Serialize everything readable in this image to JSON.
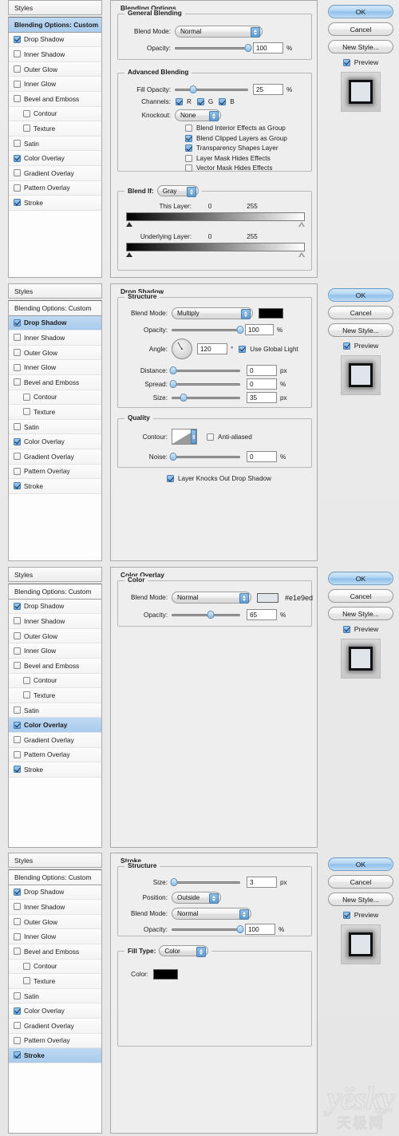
{
  "styles_panel": {
    "header_label": "Styles",
    "blending_options_label": "Blending Options: Custom",
    "items": [
      {
        "label": "Drop Shadow",
        "checked": true,
        "indent": false
      },
      {
        "label": "Inner Shadow",
        "checked": false,
        "indent": false
      },
      {
        "label": "Outer Glow",
        "checked": false,
        "indent": false
      },
      {
        "label": "Inner Glow",
        "checked": false,
        "indent": false
      },
      {
        "label": "Bevel and Emboss",
        "checked": false,
        "indent": false
      },
      {
        "label": "Contour",
        "checked": false,
        "indent": true
      },
      {
        "label": "Texture",
        "checked": false,
        "indent": true
      },
      {
        "label": "Satin",
        "checked": false,
        "indent": false
      },
      {
        "label": "Color Overlay",
        "checked": true,
        "indent": false
      },
      {
        "label": "Gradient Overlay",
        "checked": false,
        "indent": false
      },
      {
        "label": "Pattern Overlay",
        "checked": false,
        "indent": false
      },
      {
        "label": "Stroke",
        "checked": true,
        "indent": false
      }
    ]
  },
  "buttons": {
    "ok": "OK",
    "cancel": "Cancel",
    "new_style": "New Style...",
    "preview_label": "Preview",
    "preview_checked": true
  },
  "dialog1": {
    "selected_style": "Blending Options: Custom",
    "panel_title": "Blending Options",
    "general_blending": {
      "legend": "General Blending",
      "blend_mode_label": "Blend Mode:",
      "blend_mode_value": "Normal",
      "opacity_label": "Opacity:",
      "opacity_value": "100",
      "opacity_unit": "%",
      "opacity_pct": 100
    },
    "advanced_blending": {
      "legend": "Advanced Blending",
      "fill_opacity_label": "Fill Opacity:",
      "fill_opacity_value": "25",
      "fill_opacity_unit": "%",
      "fill_opacity_pct": 25,
      "channels_label": "Channels:",
      "channels": [
        {
          "label": "R",
          "checked": true
        },
        {
          "label": "G",
          "checked": true
        },
        {
          "label": "B",
          "checked": true
        }
      ],
      "knockout_label": "Knockout:",
      "knockout_value": "None",
      "checkboxes": [
        {
          "label": "Blend Interior Effects as Group",
          "checked": false
        },
        {
          "label": "Blend Clipped Layers as Group",
          "checked": true
        },
        {
          "label": "Transparency Shapes Layer",
          "checked": true
        },
        {
          "label": "Layer Mask Hides Effects",
          "checked": false
        },
        {
          "label": "Vector Mask Hides Effects",
          "checked": false
        }
      ]
    },
    "blend_if": {
      "legend": "Blend If:",
      "channel_value": "Gray",
      "this_layer_label": "This Layer:",
      "this_layer_min": "0",
      "this_layer_max": "255",
      "underlying_layer_label": "Underlying Layer:",
      "underlying_layer_min": "0",
      "underlying_layer_max": "255"
    }
  },
  "dialog2": {
    "selected_style": "Drop Shadow",
    "panel_title": "Drop Shadow",
    "structure": {
      "legend": "Structure",
      "blend_mode_label": "Blend Mode:",
      "blend_mode_value": "Multiply",
      "shadow_color": "#000000",
      "opacity_label": "Opacity:",
      "opacity_value": "100",
      "opacity_unit": "%",
      "opacity_pct": 100,
      "angle_label": "Angle:",
      "angle_value": "120",
      "angle_unit": "°",
      "use_global_light_label": "Use Global Light",
      "use_global_light_checked": true,
      "distance_label": "Distance:",
      "distance_value": "0",
      "distance_unit": "px",
      "distance_pct": 0,
      "spread_label": "Spread:",
      "spread_value": "0",
      "spread_unit": "%",
      "spread_pct": 0,
      "size_label": "Size:",
      "size_value": "35",
      "size_unit": "px",
      "size_pct": 18
    },
    "quality": {
      "legend": "Quality",
      "contour_label": "Contour:",
      "anti_aliased_label": "Anti-aliased",
      "anti_aliased_checked": false,
      "noise_label": "Noise:",
      "noise_value": "0",
      "noise_unit": "%",
      "noise_pct": 0
    },
    "layer_knocks_out_label": "Layer Knocks Out Drop Shadow",
    "layer_knocks_out_checked": true
  },
  "dialog3": {
    "selected_style": "Color Overlay",
    "panel_title": "Color Overlay",
    "color": {
      "legend": "Color",
      "blend_mode_label": "Blend Mode:",
      "blend_mode_value": "Normal",
      "color_swatch": "#e1e9ed",
      "color_hex_text": "#e1e9ed",
      "opacity_label": "Opacity:",
      "opacity_value": "65",
      "opacity_unit": "%",
      "opacity_pct": 65
    }
  },
  "dialog4": {
    "selected_style": "Stroke",
    "panel_title": "Stroke",
    "structure": {
      "legend": "Structure",
      "size_label": "Size:",
      "size_value": "3",
      "size_unit": "px",
      "size_pct": 3,
      "position_label": "Position:",
      "position_value": "Outside",
      "blend_mode_label": "Blend Mode:",
      "blend_mode_value": "Normal",
      "opacity_label": "Opacity:",
      "opacity_value": "100",
      "opacity_unit": "%",
      "opacity_pct": 100
    },
    "fill_type": {
      "legend": "Fill Type:",
      "value": "Color",
      "color_label": "Color:",
      "color_swatch": "#000000"
    }
  },
  "watermark": {
    "brand": "yësky",
    "domain": ".com",
    "chinese": "天极网"
  },
  "theme": {
    "accent": "#a9cbec",
    "dialog_bg": "#eeeeee",
    "border": "#a9a9a9"
  }
}
